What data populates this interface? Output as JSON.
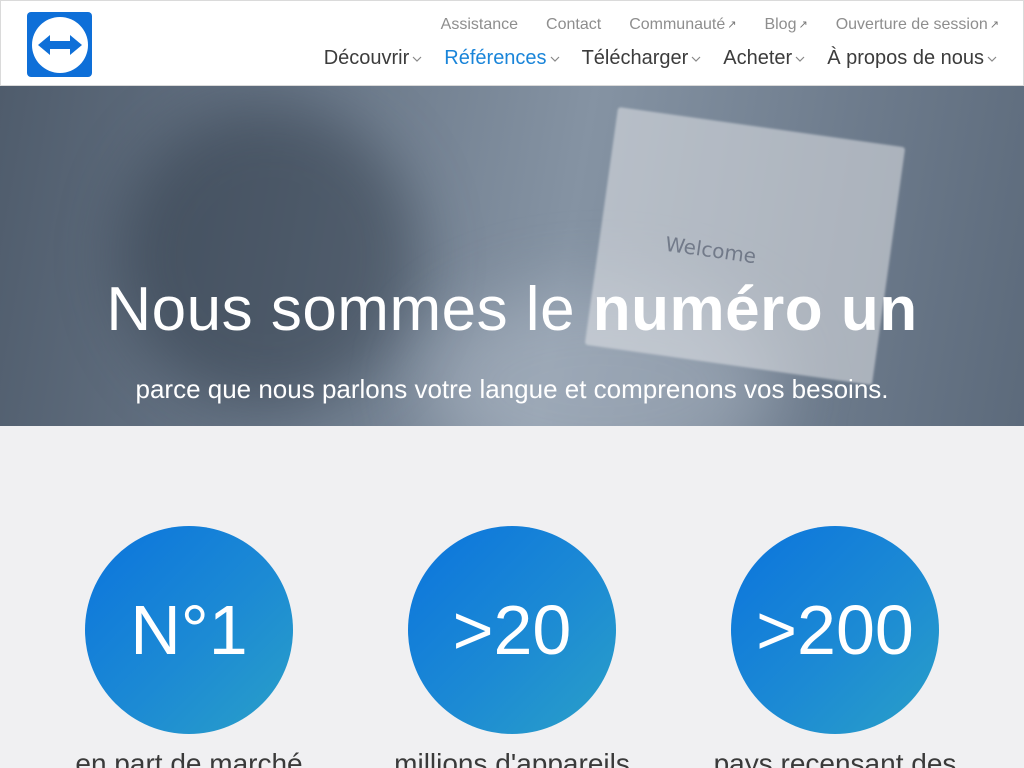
{
  "colors": {
    "accent": "#1a85d9",
    "brand": "#0e6fd8",
    "circle_start": "#0b74dd",
    "circle_end": "#2aa0c8"
  },
  "header": {
    "logo_icon": "teamviewer-arrows-icon",
    "top_links": [
      {
        "label": "Assistance",
        "external": false
      },
      {
        "label": "Contact",
        "external": false
      },
      {
        "label": "Communauté",
        "external": true
      },
      {
        "label": "Blog",
        "external": true
      },
      {
        "label": "Ouverture de session",
        "external": true
      }
    ],
    "main_nav": [
      {
        "label": "Découvrir",
        "active": false
      },
      {
        "label": "Références",
        "active": true
      },
      {
        "label": "Télécharger",
        "active": false
      },
      {
        "label": "Acheter",
        "active": false
      },
      {
        "label": "À propos de nous",
        "active": false
      }
    ]
  },
  "hero": {
    "title_regular": "Nous sommes le ",
    "title_bold": "numéro un",
    "subtitle": "parce que nous parlons votre langue et comprenons vos besoins.",
    "card_text": "Welcome"
  },
  "stats": [
    {
      "value": "N°1",
      "caption": "en part de marché"
    },
    {
      "value": ">20",
      "caption": "millions d'appareils"
    },
    {
      "value": ">200",
      "caption": "pays recensant des"
    }
  ]
}
